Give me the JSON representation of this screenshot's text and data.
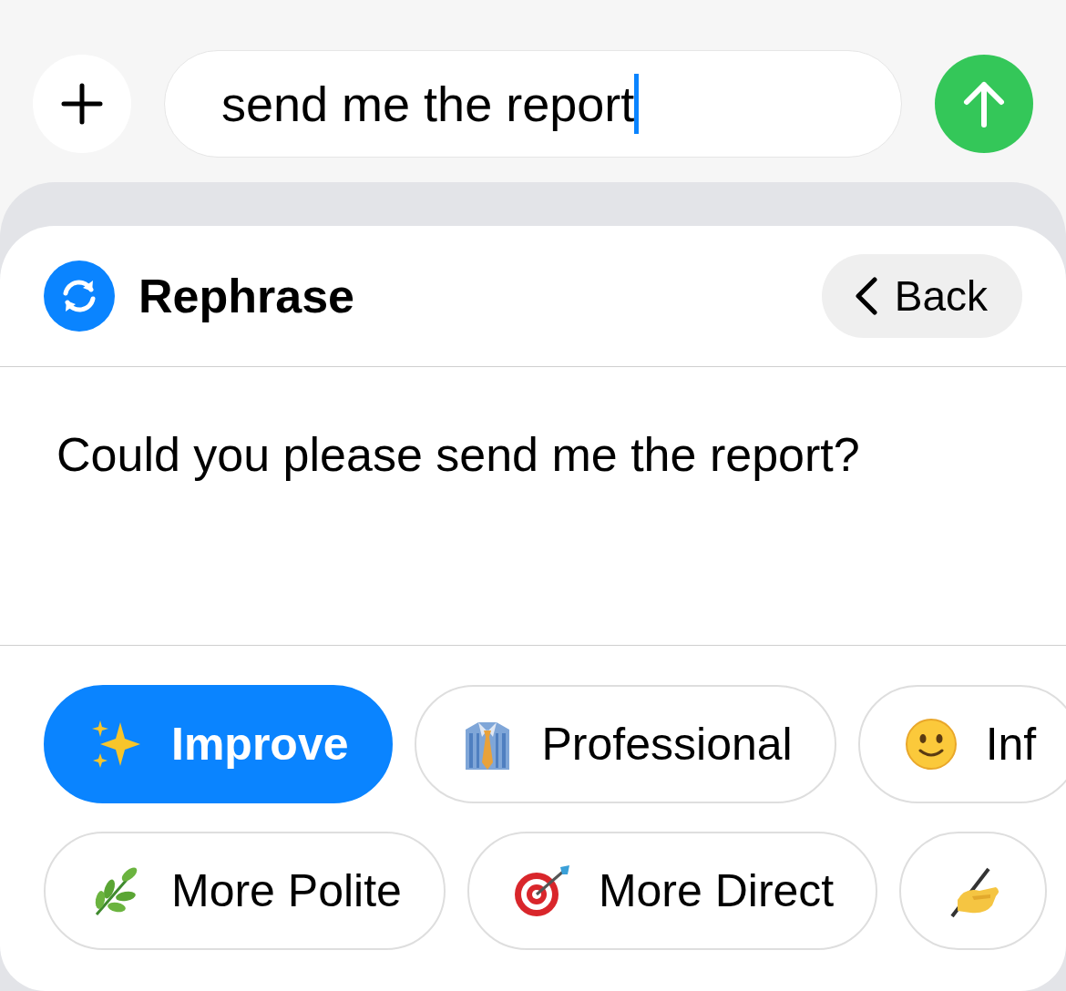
{
  "composer": {
    "message": "send me the report",
    "focused": true
  },
  "panel": {
    "title": "Rephrase",
    "back_label": "Back",
    "suggestion": "Could you please send me the report?"
  },
  "chip_rows": [
    [
      {
        "label": "Improve",
        "selected": true
      },
      {
        "label": "Professional",
        "selected": false
      },
      {
        "label": "Inf",
        "selected": false
      }
    ],
    [
      {
        "label": "More Polite",
        "selected": false
      },
      {
        "label": "More Direct",
        "selected": false
      },
      {
        "selected": false
      }
    ]
  ]
}
